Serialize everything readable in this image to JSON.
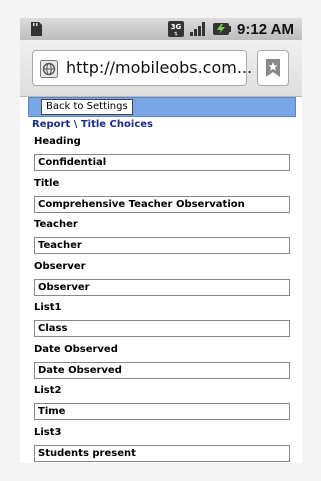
{
  "status_bar": {
    "time": "9:12 AM",
    "icons": [
      "sd-card-icon",
      "3g-icon",
      "signal-icon",
      "battery-icon"
    ]
  },
  "browser": {
    "url": "http://mobileobs.com...",
    "icons": [
      "globe-icon",
      "bookmark-icon"
    ]
  },
  "page": {
    "back_button": "Back to Settings",
    "breadcrumb": "Report \\ Title Choices",
    "fields": [
      {
        "label": "Heading",
        "value": "Confidential"
      },
      {
        "label": "Title",
        "value": "Comprehensive Teacher Observation"
      },
      {
        "label": "Teacher",
        "value": "Teacher"
      },
      {
        "label": "Observer",
        "value": "Observer"
      },
      {
        "label": "List1",
        "value": "Class"
      },
      {
        "label": "Date Observed",
        "value": "Date Observed"
      },
      {
        "label": "List2",
        "value": "Time"
      },
      {
        "label": "List3",
        "value": "Students present"
      }
    ]
  },
  "colors": {
    "header_bar": "#7aa6e6",
    "breadcrumb": "#1b2c8a"
  }
}
